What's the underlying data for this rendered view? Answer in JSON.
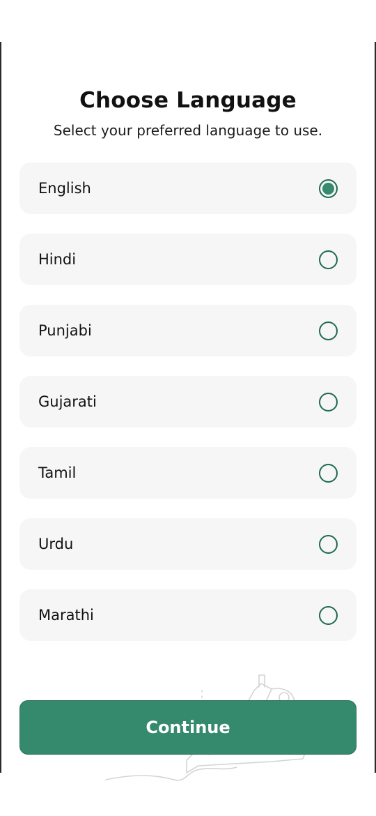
{
  "header": {
    "title": "Choose Language",
    "subtitle": "Select your preferred language to use."
  },
  "languages": [
    {
      "label": "English",
      "selected": true
    },
    {
      "label": "Hindi",
      "selected": false
    },
    {
      "label": "Punjabi",
      "selected": false
    },
    {
      "label": "Gujarati",
      "selected": false
    },
    {
      "label": "Tamil",
      "selected": false
    },
    {
      "label": "Urdu",
      "selected": false
    },
    {
      "label": "Marathi",
      "selected": false
    }
  ],
  "footer": {
    "continue_label": "Continue"
  },
  "colors": {
    "accent": "#358a6e",
    "radio_border": "#1d6b4d",
    "option_background": "#f6f6f6"
  },
  "icons": {
    "radio_selected": "radio-selected-icon",
    "radio_unselected": "radio-unselected-icon",
    "background_illustration": "sewing-machine-illustration"
  }
}
